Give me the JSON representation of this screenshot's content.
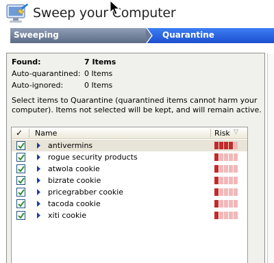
{
  "window": {
    "title": "Sweep your Computer"
  },
  "steps": [
    {
      "label": "Sweeping",
      "state": "done"
    },
    {
      "label": "Quarantine",
      "state": "active"
    }
  ],
  "stats": [
    {
      "label": "Found:",
      "value": "7 Items",
      "bold": true
    },
    {
      "label": "Auto-quarantined:",
      "value": "0 Items",
      "bold": false
    },
    {
      "label": "Auto-ignored:",
      "value": "0 Items",
      "bold": false
    }
  ],
  "instructions": "Select items to Quarantine (quarantined items cannot harm your computer).  Items not selected will be kept, and will remain active.",
  "list": {
    "columns": {
      "check": "✓",
      "name": "Name",
      "risk": "Risk"
    },
    "risk_max": 5,
    "colors": {
      "risk_on": "#c42a2a",
      "risk_off": "#f2b8b8",
      "check": "#2f8f2f",
      "expander": "#1b3f9a"
    },
    "rows": [
      {
        "name": "antivermins",
        "checked": true,
        "risk": 4,
        "selected": true
      },
      {
        "name": "rogue security products",
        "checked": true,
        "risk": 1,
        "selected": false
      },
      {
        "name": "atwola cookie",
        "checked": true,
        "risk": 1,
        "selected": false
      },
      {
        "name": "bizrate cookie",
        "checked": true,
        "risk": 1,
        "selected": false
      },
      {
        "name": "pricegrabber cookie",
        "checked": true,
        "risk": 1,
        "selected": false
      },
      {
        "name": "tacoda cookie",
        "checked": true,
        "risk": 1,
        "selected": false
      },
      {
        "name": "xiti cookie",
        "checked": true,
        "risk": 1,
        "selected": false
      }
    ]
  }
}
